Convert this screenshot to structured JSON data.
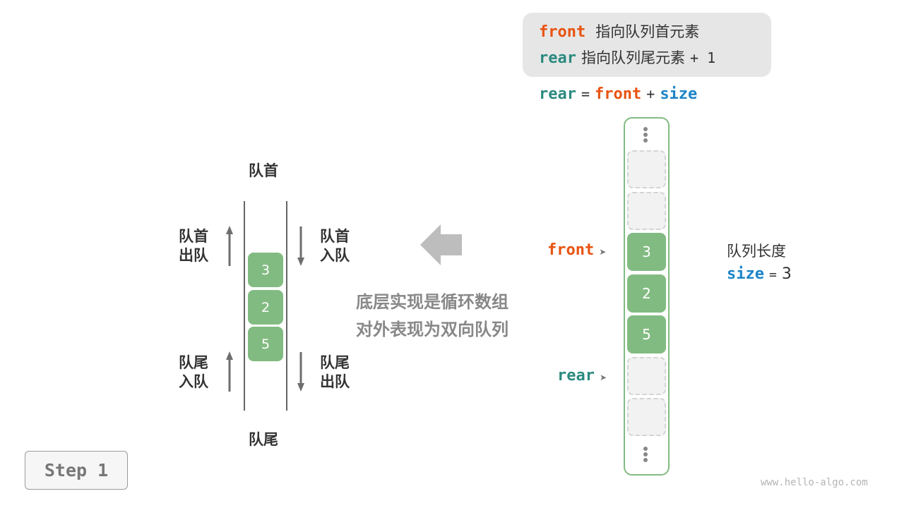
{
  "legend": {
    "line1": {
      "var": "front",
      "desc": "指向队列首元素"
    },
    "line2": {
      "var": "rear",
      "desc": "指向队列尾元素",
      "suffix": "+ 1"
    },
    "formula": {
      "lhs": "rear",
      "eq": "=",
      "a": "front",
      "plus": "+",
      "b": "size"
    }
  },
  "deque_view": {
    "top_label": "队首",
    "bottom_label": "队尾",
    "front_pop_label": [
      "队首",
      "出队"
    ],
    "front_push_label": [
      "队首",
      "入队"
    ],
    "rear_push_label": [
      "队尾",
      "入队"
    ],
    "rear_pop_label": [
      "队尾",
      "出队"
    ],
    "elements": [
      "3",
      "2",
      "5"
    ]
  },
  "caption": {
    "line1": "底层实现是循环数组",
    "line2": "对外表现为双向队列"
  },
  "array_view": {
    "cells": [
      {
        "value": "",
        "filled": false
      },
      {
        "value": "",
        "filled": false
      },
      {
        "value": "3",
        "filled": true
      },
      {
        "value": "2",
        "filled": true
      },
      {
        "value": "5",
        "filled": true
      },
      {
        "value": "",
        "filled": false
      },
      {
        "value": "",
        "filled": false
      }
    ],
    "front_label": "front",
    "rear_label": "rear",
    "front_index": 2,
    "rear_index": 5
  },
  "size_info": {
    "title": "队列长度",
    "var": "size",
    "eq": "=",
    "value": "3"
  },
  "step_button": {
    "label": "Step 1"
  },
  "watermark": "www.hello-algo.com",
  "colors": {
    "front": "#e85312",
    "rear": "#2b8a7f",
    "size": "#1d84c8",
    "cell_fill": "#82bb82",
    "empty_cell": "#f2f2f2"
  }
}
